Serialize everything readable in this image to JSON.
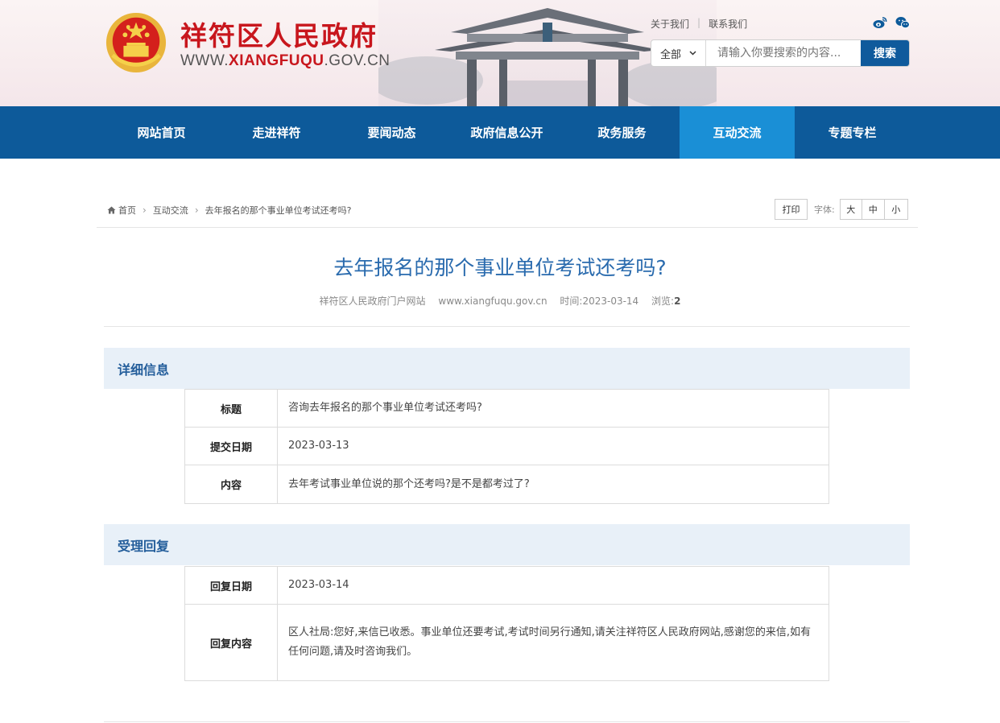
{
  "header": {
    "site_name": "祥符区人民政府",
    "url_prefix": "WWW.",
    "url_highlight": "XIANGFUQU",
    "url_suffix": ".GOV.CN",
    "top_links": [
      "关于我们",
      "联系我们"
    ],
    "separator": "|",
    "search": {
      "scope": "全部",
      "placeholder": "请输入你要搜索的内容...",
      "button": "搜索"
    }
  },
  "nav": {
    "items": [
      "网站首页",
      "走进祥符",
      "要闻动态",
      "政府信息公开",
      "政务服务",
      "互动交流",
      "专题专栏"
    ],
    "active_index": 5
  },
  "breadcrumb": {
    "home": "首页",
    "section": "互动交流",
    "current": "去年报名的那个事业单位考试还考吗?"
  },
  "tools": {
    "print": "打印",
    "font_label": "字体:",
    "sizes": [
      "大",
      "中",
      "小"
    ]
  },
  "article": {
    "title": "去年报名的那个事业单位考试还考吗?",
    "source": "祥符区人民政府门户网站",
    "site": "www.xiangfuqu.gov.cn",
    "time_label": "时间:",
    "time": "2023-03-14",
    "views_label": "浏览:",
    "views": "2"
  },
  "detail": {
    "heading": "详细信息",
    "rows": [
      {
        "key": "标题",
        "value": "咨询去年报名的那个事业单位考试还考吗?"
      },
      {
        "key": "提交日期",
        "value": "2023-03-13"
      },
      {
        "key": "内容",
        "value": "去年考试事业单位说的那个还考吗?是不是都考过了?"
      }
    ]
  },
  "reply": {
    "heading": "受理回复",
    "rows": [
      {
        "key": "回复日期",
        "value": "2023-03-14"
      },
      {
        "key": "回复内容",
        "value": "区人社局:您好,来信已收悉。事业单位还要考试,考试时间另行通知,请关注祥符区人民政府网站,感谢您的来信,如有任何问题,请及时咨询我们。"
      }
    ]
  },
  "colors": {
    "nav_bg": "#0d5a9a",
    "nav_active": "#1a8fd6",
    "brand_red": "#c8161d",
    "title_blue": "#2a6bae"
  }
}
